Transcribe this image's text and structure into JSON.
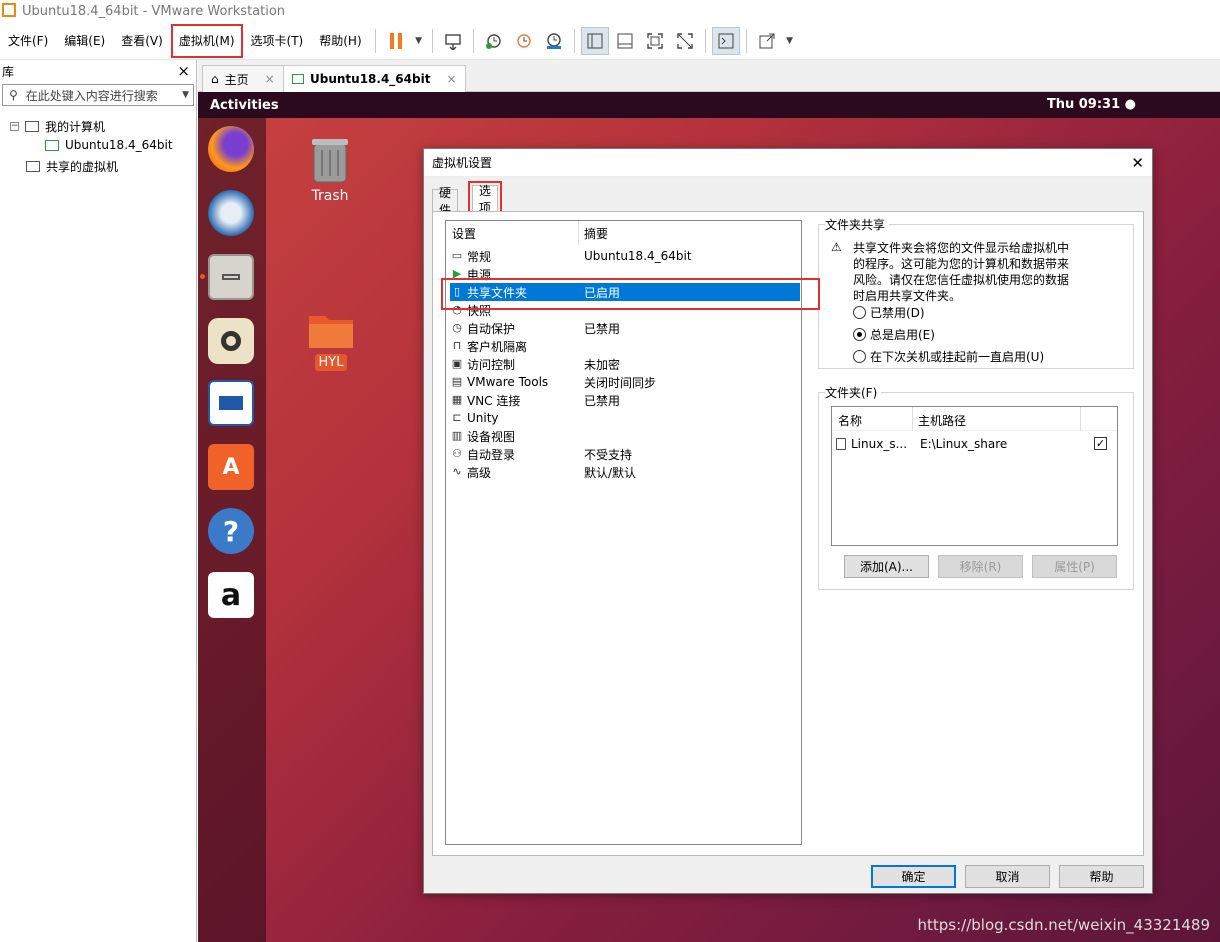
{
  "window": {
    "title": "Ubuntu18.4_64bit - VMware Workstation"
  },
  "menu": {
    "file": "文件(F)",
    "edit": "编辑(E)",
    "view": "查看(V)",
    "vm": "虚拟机(M)",
    "tabs": "选项卡(T)",
    "help": "帮助(H)"
  },
  "toolbar_icons": [
    "pause-icon",
    "send-keys-icon",
    "snapshot-icon",
    "revert-snapshot-icon",
    "manage-snapshots-icon",
    "library-view-icon",
    "thumbnail-view-icon",
    "fullscreen-icon",
    "unity-icon",
    "console-icon",
    "stretch-icon"
  ],
  "library": {
    "title": "库",
    "close": "×",
    "search_placeholder": "在此处键入内容进行搜索",
    "tree": [
      {
        "label": "我的计算机",
        "toggle": "⊟"
      },
      {
        "label": "Ubuntu18.4_64bit"
      },
      {
        "label": "共享的虚拟机"
      }
    ]
  },
  "tabs": [
    {
      "label": "主页",
      "close": "×"
    },
    {
      "label": "Ubuntu18.4_64bit",
      "close": "×"
    }
  ],
  "guest": {
    "activities": "Activities",
    "clock": "Thu 09:31",
    "trash": "Trash",
    "folder": "HYL"
  },
  "dialog": {
    "title": "虚拟机设置",
    "close": "✕",
    "tabs": {
      "hardware": "硬件",
      "options": "选项"
    },
    "columns": {
      "setting": "设置",
      "summary": "摘要"
    },
    "settings": [
      {
        "name": "常规",
        "value": "Ubuntu18.4_64bit",
        "icon": "general-icon"
      },
      {
        "name": "电源",
        "value": "",
        "icon": "power-icon"
      },
      {
        "name": "共享文件夹",
        "value": "已启用",
        "icon": "shared-folder-icon"
      },
      {
        "name": "快照",
        "value": "",
        "icon": "snapshot-icon"
      },
      {
        "name": "自动保护",
        "value": "已禁用",
        "icon": "autoprotect-icon"
      },
      {
        "name": "客户机隔离",
        "value": "",
        "icon": "isolation-icon"
      },
      {
        "name": "访问控制",
        "value": "未加密",
        "icon": "access-control-icon"
      },
      {
        "name": "VMware Tools",
        "value": "关闭时间同步",
        "icon": "vmware-tools-icon"
      },
      {
        "name": "VNC 连接",
        "value": "已禁用",
        "icon": "vnc-icon"
      },
      {
        "name": "Unity",
        "value": "",
        "icon": "unity-icon"
      },
      {
        "name": "设备视图",
        "value": "",
        "icon": "device-view-icon"
      },
      {
        "name": "自动登录",
        "value": "不受支持",
        "icon": "autologin-icon"
      },
      {
        "name": "高级",
        "value": "默认/默认",
        "icon": "advanced-icon"
      }
    ],
    "sharing": {
      "group_label": "文件夹共享",
      "warning_1": "共享文件夹会将您的文件显示给虚拟机中",
      "warning_2": "的程序。这可能为您的计算机和数据带来",
      "warning_3": "风险。请仅在您信任虚拟机使用您的数据",
      "warning_4": "时启用共享文件夹。",
      "disabled": "已禁用(D)",
      "always": "总是启用(E)",
      "until_off": "在下次关机或挂起前一直启用(U)",
      "selected": "always"
    },
    "folders": {
      "group_label": "文件夹(F)",
      "col_name": "名称",
      "col_path": "主机路径",
      "rows": [
        {
          "name": "Linux_s...",
          "path": "E:\\Linux_share",
          "checked": true
        }
      ],
      "add": "添加(A)...",
      "remove": "移除(R)",
      "properties": "属性(P)"
    },
    "ok": "确定",
    "cancel": "取消",
    "help": "帮助"
  },
  "watermark": "https://blog.csdn.net/weixin_43321489"
}
